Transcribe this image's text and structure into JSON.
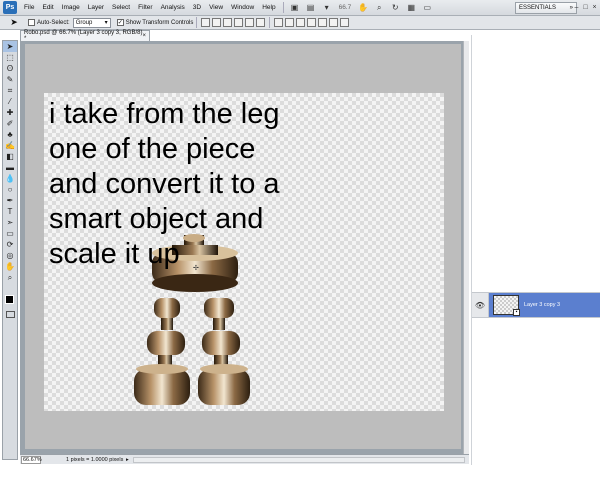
{
  "menubar": {
    "logo": "Ps",
    "items": [
      "File",
      "Edit",
      "Image",
      "Layer",
      "Select",
      "Filter",
      "Analysis",
      "3D",
      "View",
      "Window",
      "Help"
    ],
    "zoom": "66.7",
    "workspace": "ESSENTIALS"
  },
  "options": {
    "auto_select_label": "Auto-Select:",
    "auto_select_checked": false,
    "auto_select_value": "Group",
    "transform_label": "Show Transform Controls",
    "transform_checked": true
  },
  "tools": [
    "move-tool",
    "marquee-tool",
    "lasso-tool",
    "quick-selection-tool",
    "crop-tool",
    "eyedropper-tool",
    "healing-brush-tool",
    "brush-tool",
    "clone-stamp-tool",
    "history-brush-tool",
    "eraser-tool",
    "gradient-tool",
    "blur-tool",
    "dodge-tool",
    "pen-tool",
    "type-tool",
    "path-selection-tool",
    "shape-tool",
    "3d-rotate-tool",
    "3d-orbit-tool",
    "hand-tool",
    "zoom-tool"
  ],
  "document": {
    "tab_title": "Robo.psd @ 66.7% (Layer 3 copy 3, RGB/8) *",
    "canvas_text": "i take from the leg one of the piece and convert it to a smart object and scale it up",
    "zoom_status": "66.67%",
    "doc_info": "1 pixels = 1.0000 pixels"
  },
  "layers": {
    "selected_layer": "Layer 3 copy 3"
  },
  "colors": {
    "foreground": "#000000",
    "background": "#ffffff",
    "selected_layer": "#5b7fcf"
  }
}
